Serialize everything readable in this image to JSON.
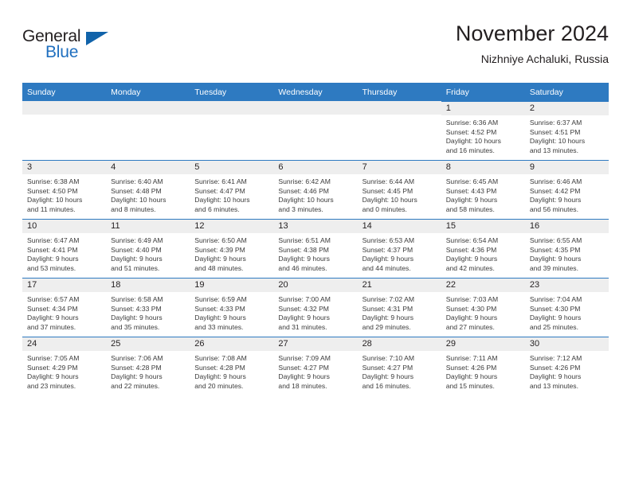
{
  "brand": {
    "line1": "General",
    "line2": "Blue",
    "triangle_icon": "brand-triangle-icon",
    "accent_color": "#1163aa"
  },
  "header": {
    "title": "November 2024",
    "subtitle": "Nizhniye Achaluki, Russia"
  },
  "theme": {
    "header_bg": "#2e7ac1",
    "date_strip_bg": "#eeeeee",
    "cell_border": "#2e7ac1",
    "text": "#231f20",
    "body_text": "#3b3b3b"
  },
  "columns": [
    "Sunday",
    "Monday",
    "Tuesday",
    "Wednesday",
    "Thursday",
    "Friday",
    "Saturday"
  ],
  "labels": {
    "sunrise": "Sunrise:",
    "sunset": "Sunset:",
    "daylight": "Daylight:"
  },
  "weeks": [
    [
      {
        "empty": true
      },
      {
        "empty": true
      },
      {
        "empty": true
      },
      {
        "empty": true
      },
      {
        "empty": true
      },
      {
        "day": "1",
        "sunrise": "Sunrise: 6:36 AM",
        "sunset": "Sunset: 4:52 PM",
        "daylight_l1": "Daylight: 10 hours",
        "daylight_l2": "and 16 minutes."
      },
      {
        "day": "2",
        "sunrise": "Sunrise: 6:37 AM",
        "sunset": "Sunset: 4:51 PM",
        "daylight_l1": "Daylight: 10 hours",
        "daylight_l2": "and 13 minutes."
      }
    ],
    [
      {
        "day": "3",
        "sunrise": "Sunrise: 6:38 AM",
        "sunset": "Sunset: 4:50 PM",
        "daylight_l1": "Daylight: 10 hours",
        "daylight_l2": "and 11 minutes."
      },
      {
        "day": "4",
        "sunrise": "Sunrise: 6:40 AM",
        "sunset": "Sunset: 4:48 PM",
        "daylight_l1": "Daylight: 10 hours",
        "daylight_l2": "and 8 minutes."
      },
      {
        "day": "5",
        "sunrise": "Sunrise: 6:41 AM",
        "sunset": "Sunset: 4:47 PM",
        "daylight_l1": "Daylight: 10 hours",
        "daylight_l2": "and 6 minutes."
      },
      {
        "day": "6",
        "sunrise": "Sunrise: 6:42 AM",
        "sunset": "Sunset: 4:46 PM",
        "daylight_l1": "Daylight: 10 hours",
        "daylight_l2": "and 3 minutes."
      },
      {
        "day": "7",
        "sunrise": "Sunrise: 6:44 AM",
        "sunset": "Sunset: 4:45 PM",
        "daylight_l1": "Daylight: 10 hours",
        "daylight_l2": "and 0 minutes."
      },
      {
        "day": "8",
        "sunrise": "Sunrise: 6:45 AM",
        "sunset": "Sunset: 4:43 PM",
        "daylight_l1": "Daylight: 9 hours",
        "daylight_l2": "and 58 minutes."
      },
      {
        "day": "9",
        "sunrise": "Sunrise: 6:46 AM",
        "sunset": "Sunset: 4:42 PM",
        "daylight_l1": "Daylight: 9 hours",
        "daylight_l2": "and 56 minutes."
      }
    ],
    [
      {
        "day": "10",
        "sunrise": "Sunrise: 6:47 AM",
        "sunset": "Sunset: 4:41 PM",
        "daylight_l1": "Daylight: 9 hours",
        "daylight_l2": "and 53 minutes."
      },
      {
        "day": "11",
        "sunrise": "Sunrise: 6:49 AM",
        "sunset": "Sunset: 4:40 PM",
        "daylight_l1": "Daylight: 9 hours",
        "daylight_l2": "and 51 minutes."
      },
      {
        "day": "12",
        "sunrise": "Sunrise: 6:50 AM",
        "sunset": "Sunset: 4:39 PM",
        "daylight_l1": "Daylight: 9 hours",
        "daylight_l2": "and 48 minutes."
      },
      {
        "day": "13",
        "sunrise": "Sunrise: 6:51 AM",
        "sunset": "Sunset: 4:38 PM",
        "daylight_l1": "Daylight: 9 hours",
        "daylight_l2": "and 46 minutes."
      },
      {
        "day": "14",
        "sunrise": "Sunrise: 6:53 AM",
        "sunset": "Sunset: 4:37 PM",
        "daylight_l1": "Daylight: 9 hours",
        "daylight_l2": "and 44 minutes."
      },
      {
        "day": "15",
        "sunrise": "Sunrise: 6:54 AM",
        "sunset": "Sunset: 4:36 PM",
        "daylight_l1": "Daylight: 9 hours",
        "daylight_l2": "and 42 minutes."
      },
      {
        "day": "16",
        "sunrise": "Sunrise: 6:55 AM",
        "sunset": "Sunset: 4:35 PM",
        "daylight_l1": "Daylight: 9 hours",
        "daylight_l2": "and 39 minutes."
      }
    ],
    [
      {
        "day": "17",
        "sunrise": "Sunrise: 6:57 AM",
        "sunset": "Sunset: 4:34 PM",
        "daylight_l1": "Daylight: 9 hours",
        "daylight_l2": "and 37 minutes."
      },
      {
        "day": "18",
        "sunrise": "Sunrise: 6:58 AM",
        "sunset": "Sunset: 4:33 PM",
        "daylight_l1": "Daylight: 9 hours",
        "daylight_l2": "and 35 minutes."
      },
      {
        "day": "19",
        "sunrise": "Sunrise: 6:59 AM",
        "sunset": "Sunset: 4:33 PM",
        "daylight_l1": "Daylight: 9 hours",
        "daylight_l2": "and 33 minutes."
      },
      {
        "day": "20",
        "sunrise": "Sunrise: 7:00 AM",
        "sunset": "Sunset: 4:32 PM",
        "daylight_l1": "Daylight: 9 hours",
        "daylight_l2": "and 31 minutes."
      },
      {
        "day": "21",
        "sunrise": "Sunrise: 7:02 AM",
        "sunset": "Sunset: 4:31 PM",
        "daylight_l1": "Daylight: 9 hours",
        "daylight_l2": "and 29 minutes."
      },
      {
        "day": "22",
        "sunrise": "Sunrise: 7:03 AM",
        "sunset": "Sunset: 4:30 PM",
        "daylight_l1": "Daylight: 9 hours",
        "daylight_l2": "and 27 minutes."
      },
      {
        "day": "23",
        "sunrise": "Sunrise: 7:04 AM",
        "sunset": "Sunset: 4:30 PM",
        "daylight_l1": "Daylight: 9 hours",
        "daylight_l2": "and 25 minutes."
      }
    ],
    [
      {
        "day": "24",
        "sunrise": "Sunrise: 7:05 AM",
        "sunset": "Sunset: 4:29 PM",
        "daylight_l1": "Daylight: 9 hours",
        "daylight_l2": "and 23 minutes."
      },
      {
        "day": "25",
        "sunrise": "Sunrise: 7:06 AM",
        "sunset": "Sunset: 4:28 PM",
        "daylight_l1": "Daylight: 9 hours",
        "daylight_l2": "and 22 minutes."
      },
      {
        "day": "26",
        "sunrise": "Sunrise: 7:08 AM",
        "sunset": "Sunset: 4:28 PM",
        "daylight_l1": "Daylight: 9 hours",
        "daylight_l2": "and 20 minutes."
      },
      {
        "day": "27",
        "sunrise": "Sunrise: 7:09 AM",
        "sunset": "Sunset: 4:27 PM",
        "daylight_l1": "Daylight: 9 hours",
        "daylight_l2": "and 18 minutes."
      },
      {
        "day": "28",
        "sunrise": "Sunrise: 7:10 AM",
        "sunset": "Sunset: 4:27 PM",
        "daylight_l1": "Daylight: 9 hours",
        "daylight_l2": "and 16 minutes."
      },
      {
        "day": "29",
        "sunrise": "Sunrise: 7:11 AM",
        "sunset": "Sunset: 4:26 PM",
        "daylight_l1": "Daylight: 9 hours",
        "daylight_l2": "and 15 minutes."
      },
      {
        "day": "30",
        "sunrise": "Sunrise: 7:12 AM",
        "sunset": "Sunset: 4:26 PM",
        "daylight_l1": "Daylight: 9 hours",
        "daylight_l2": "and 13 minutes."
      }
    ]
  ]
}
